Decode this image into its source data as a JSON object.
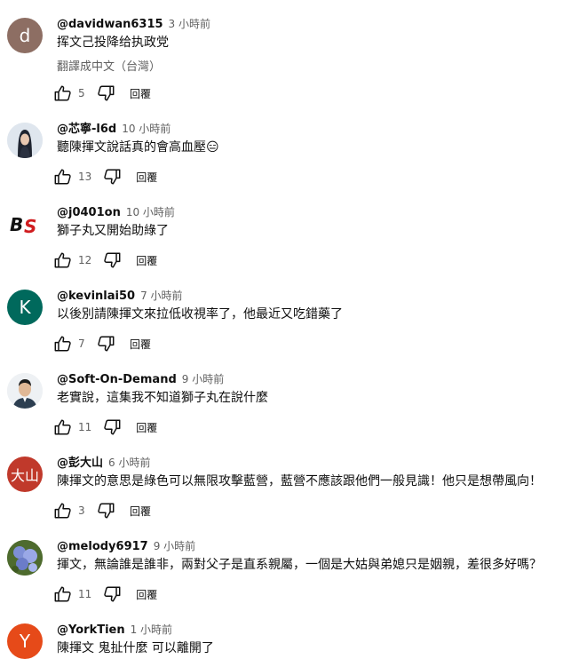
{
  "reply_label": "回覆",
  "comments": [
    {
      "author": "@davidwan6315",
      "time": "3 小時前",
      "text": "挥文己投降给执政党",
      "translate": "翻譯成中文（台灣）",
      "likes": "5",
      "avatar": {
        "type": "letter",
        "letter": "d",
        "color": "#8d6e63"
      }
    },
    {
      "author": "@芯寧-l6d",
      "time": "10 小時前",
      "text": "聽陳揮文說話真的會高血壓😑",
      "likes": "13",
      "avatar": {
        "type": "photo-woman"
      }
    },
    {
      "author": "@j0401on",
      "time": "10 小時前",
      "text": "獅子丸又開始助綠了",
      "likes": "12",
      "avatar": {
        "type": "logo-bs"
      }
    },
    {
      "author": "@kevinlai50",
      "time": "7 小時前",
      "text": "以後別請陳揮文來拉低收視率了，他最近又吃錯藥了",
      "likes": "7",
      "avatar": {
        "type": "letter",
        "letter": "K",
        "color": "#00695c"
      }
    },
    {
      "author": "@Soft-On-Demand",
      "time": "9 小時前",
      "text": "老實說，這集我不知道獅子丸在說什麼",
      "likes": "11",
      "avatar": {
        "type": "photo-man"
      }
    },
    {
      "author": "@彭大山",
      "time": "6 小時前",
      "text": "陳揮文的意思是綠色可以無限攻擊藍營，藍營不應該跟他們一般見識！他只是想帶風向！",
      "likes": "3",
      "avatar": {
        "type": "text",
        "letter": "大山",
        "color": "#c0392b"
      }
    },
    {
      "author": "@melody6917",
      "time": "9 小時前",
      "text": "揮文，無論誰是誰非，兩對父子是直系親屬，一個是大姑與弟媳只是姻親，差很多好嗎？",
      "likes": "11",
      "avatar": {
        "type": "photo-flowers"
      }
    },
    {
      "author": "@YorkTien",
      "time": "1 小時前",
      "text": "陳揮文 鬼扯什麼 可以離開了",
      "avatar": {
        "type": "letter",
        "letter": "Y",
        "color": "#e64a19"
      }
    }
  ]
}
